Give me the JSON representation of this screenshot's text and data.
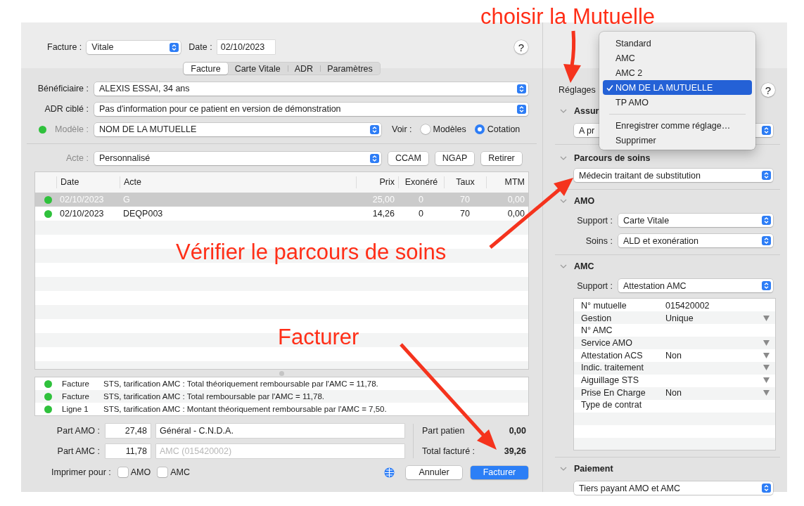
{
  "annotations": [
    {
      "text": "choisir la Mutuelle"
    },
    {
      "text": "Vérifier le parcours de soins"
    },
    {
      "text": "Facturer"
    }
  ],
  "invoice": {
    "facture_label": "Facture :",
    "facture_type": "Vitale",
    "date_label": "Date :",
    "date": "02/10/2023",
    "help": "?",
    "tabs": [
      {
        "label": "Facture",
        "selected": true
      },
      {
        "label": "Carte Vitale",
        "selected": false
      },
      {
        "label": "ADR",
        "selected": false
      },
      {
        "label": "Paramètres",
        "selected": false
      }
    ],
    "fields": [
      {
        "label": "Bénéficiaire :",
        "value": "ALEXIS ESSAI, 34 ans"
      },
      {
        "label": "ADR ciblé :",
        "value": "Pas d'information pour ce patient en version de démonstration"
      }
    ],
    "model": {
      "label": "Modèle :",
      "value": "NOM DE LA MUTUELLE",
      "view_label": "Voir :",
      "view_options": [
        {
          "label": "Modèles",
          "selected": false
        },
        {
          "label": "Cotation",
          "selected": true
        }
      ]
    },
    "act": {
      "label": "Acte :",
      "value": "Personnalisé",
      "buttons": [
        "CCAM",
        "NGAP",
        "Retirer"
      ]
    },
    "table": {
      "columns": [
        "Date",
        "Acte",
        "Prix",
        "Exonéré",
        "Taux",
        "MTM"
      ],
      "rows": [
        {
          "selected": true,
          "color": "#2fc13c",
          "cells": [
            "02/10/2023",
            "G",
            "25,00",
            "0",
            "70",
            "0,00"
          ]
        },
        {
          "selected": false,
          "color": "#2fc13c",
          "cells": [
            "02/10/2023",
            "DEQP003",
            "14,26",
            "0",
            "70",
            "0,00"
          ]
        }
      ]
    },
    "messages": [
      {
        "color": "#2fc13c",
        "source": "Facture",
        "text": "STS, tarification AMC : Total théoriquement remboursable par l'AMC = 11,78."
      },
      {
        "color": "#2fc13c",
        "source": "Facture",
        "text": "STS, tarification AMC : Total remboursable par l'AMC = 11,78."
      },
      {
        "color": "#2fc13c",
        "source": "Ligne 1",
        "text": "STS, tarification AMC : Montant théoriquement remboursable par l'AMC = 7,50."
      }
    ],
    "shares": [
      {
        "label": "Part AMO :",
        "amount": "27,48",
        "payer": "Général - C.N.D.A."
      },
      {
        "label": "Part AMC :",
        "amount": "11,78",
        "placeholder": "AMC (015420002)"
      }
    ],
    "summary": [
      {
        "label": "Part patien",
        "value": "0,00"
      },
      {
        "label": "Total facturé :",
        "value": "39,26"
      }
    ],
    "print": {
      "label": "Imprimer pour :",
      "options": [
        {
          "label": "AMO",
          "checked": false
        },
        {
          "label": "AMC",
          "checked": false
        }
      ]
    },
    "buttons": [
      {
        "label": "Annuler",
        "kind": "default"
      },
      {
        "label": "Facturer",
        "kind": "primary"
      }
    ]
  },
  "settings": {
    "label": "Réglages",
    "help": "?",
    "menu": [
      {
        "kind": "item",
        "label": "Standard",
        "selected": false
      },
      {
        "kind": "item",
        "label": "AMC",
        "selected": false
      },
      {
        "kind": "item",
        "label": "AMC 2",
        "selected": false
      },
      {
        "kind": "item",
        "label": "NOM DE LA MUTUELLE",
        "selected": true
      },
      {
        "kind": "item",
        "label": "TP AMO",
        "selected": false
      },
      {
        "kind": "separator"
      },
      {
        "kind": "item",
        "label": "Enregistrer comme réglage…",
        "selected": false
      },
      {
        "kind": "item",
        "label": "Supprimer",
        "selected": false
      }
    ],
    "sections": [
      {
        "title": "Assur",
        "expanded": true,
        "popup": "A pr"
      },
      {
        "title": "Parcours de soins",
        "expanded": true,
        "popup": "Médecin traitant de substitution"
      },
      {
        "title": "AMO",
        "expanded": true,
        "fields": [
          {
            "label": "Support :",
            "value": "Carte Vitale"
          },
          {
            "label": "Soins :",
            "value": "ALD et exonération"
          }
        ]
      },
      {
        "title": "AMC",
        "expanded": true,
        "fields": [
          {
            "label": "Support :",
            "value": "Attestation AMC"
          }
        ],
        "properties": [
          {
            "name": "N° mutuelle",
            "value": "015420002",
            "dropdown": false
          },
          {
            "name": "Gestion",
            "value": "Unique",
            "dropdown": true
          },
          {
            "name": "N° AMC",
            "dropdown": false
          },
          {
            "name": "Service AMO",
            "dropdown": true
          },
          {
            "name": "Attestation ACS",
            "value": "Non",
            "dropdown": true
          },
          {
            "name": "Indic. traitement",
            "dropdown": true
          },
          {
            "name": "Aiguillage STS",
            "dropdown": true
          },
          {
            "name": "Prise En Charge",
            "value": "Non",
            "dropdown": true
          },
          {
            "name": "Type de contrat",
            "dropdown": false
          }
        ]
      },
      {
        "title": "Paiement",
        "expanded": true,
        "popup": "Tiers payant AMO et AMC"
      }
    ]
  }
}
